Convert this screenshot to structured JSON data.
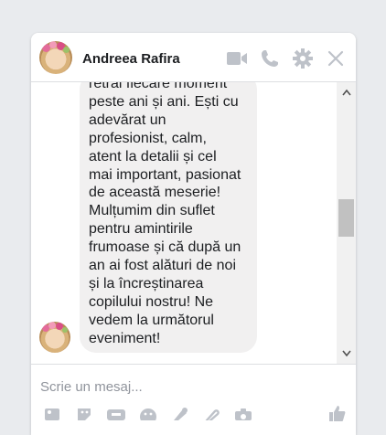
{
  "chat": {
    "contact_name": "Andreea Rafira",
    "message_lines": [
      "retrai fiecare moment",
      "peste ani și ani. Ești cu",
      "adevărat un",
      "profesionist, calm,",
      "atent la detalii și cel",
      "mai important, pasionat",
      "de această meserie!",
      "Mulțumim din suflet",
      "pentru amintirile",
      "frumoase și că după un",
      "an ai fost alături de noi",
      "și la încreștinarea",
      "copilului nostru! Ne",
      "vedem la următorul",
      "eveniment!"
    ]
  },
  "header": {
    "icons": [
      "video-camera-icon",
      "phone-icon",
      "gear-icon",
      "close-icon"
    ]
  },
  "composer": {
    "placeholder": "Scrie un mesaj...",
    "value": "",
    "toolbar_icons": [
      "image-icon",
      "sticker-icon",
      "gif-icon",
      "emoji-icon",
      "game-icon",
      "attachment-icon",
      "camera-icon",
      "like-icon"
    ]
  },
  "colors": {
    "icon_gray": "#bec2c9",
    "bubble": "#f1f0f0",
    "like_blue": "#bec2c9"
  }
}
